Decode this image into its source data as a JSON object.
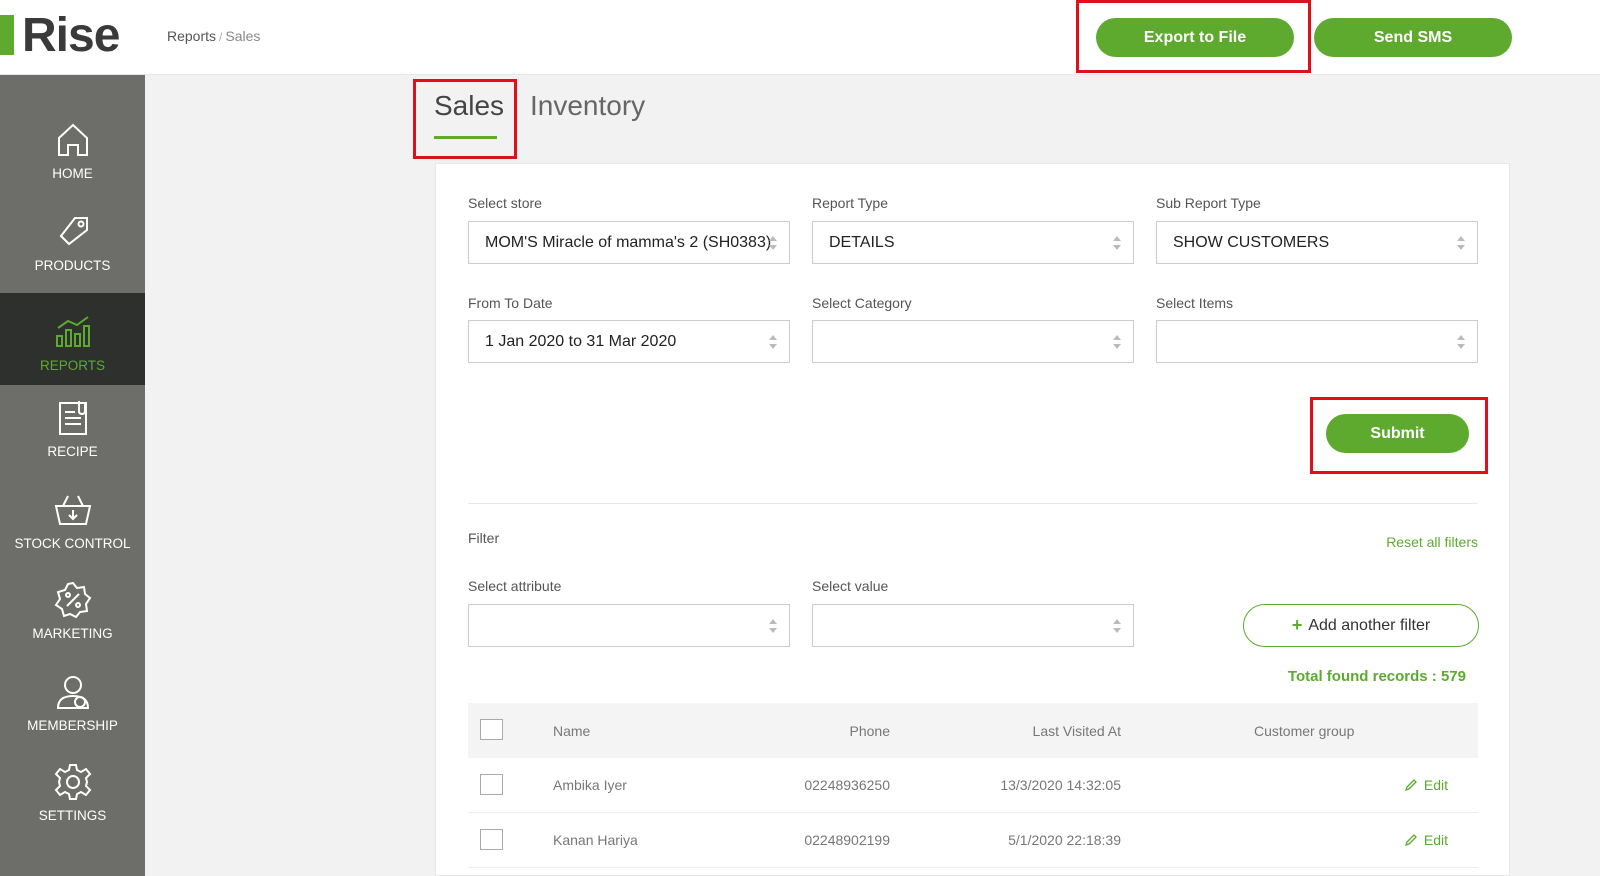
{
  "app": {
    "logo": "Rise"
  },
  "breadcrumb": {
    "parent": "Reports",
    "separator": "/",
    "current": "Sales"
  },
  "header": {
    "export_label": "Export to File",
    "sms_label": "Send SMS"
  },
  "sidebar": {
    "items": [
      {
        "label": "HOME",
        "icon": "home-icon"
      },
      {
        "label": "PRODUCTS",
        "icon": "tag-icon"
      },
      {
        "label": "REPORTS",
        "icon": "chart-icon",
        "active": true
      },
      {
        "label": "RECIPE",
        "icon": "recipe-icon"
      },
      {
        "label": "STOCK CONTROL",
        "icon": "basket-icon"
      },
      {
        "label": "MARKETING",
        "icon": "percent-badge-icon"
      },
      {
        "label": "MEMBERSHIP",
        "icon": "members-icon"
      },
      {
        "label": "SETTINGS",
        "icon": "gear-icon"
      }
    ]
  },
  "tabs": {
    "sales": "Sales",
    "inventory": "Inventory"
  },
  "form": {
    "store_label": "Select store",
    "store_value": "MOM'S Miracle of mamma's 2 (SH0383)",
    "report_type_label": "Report Type",
    "report_type_value": "DETAILS",
    "sub_report_label": "Sub Report Type",
    "sub_report_value": "SHOW CUSTOMERS",
    "date_label": "From To Date",
    "date_value": "1 Jan 2020 to 31 Mar 2020",
    "category_label": "Select Category",
    "category_value": "",
    "items_label": "Select Items",
    "items_value": "",
    "submit_label": "Submit"
  },
  "filter": {
    "title": "Filter",
    "reset_label": "Reset all filters",
    "attribute_label": "Select attribute",
    "attribute_value": "",
    "value_label": "Select value",
    "value_value": "",
    "add_label": "Add another filter",
    "total_text": "Total found records : 579"
  },
  "table": {
    "headers": {
      "name": "Name",
      "phone": "Phone",
      "last_visited": "Last Visited At",
      "group": "Customer group"
    },
    "edit_label": "Edit",
    "rows": [
      {
        "name": "Ambika Iyer",
        "phone": "02248936250",
        "last_visited": "13/3/2020 14:32:05",
        "group": ""
      },
      {
        "name": "Kanan Hariya",
        "phone": "02248902199",
        "last_visited": "5/1/2020 22:18:39",
        "group": ""
      }
    ]
  },
  "colors": {
    "accent": "#5eaa2f",
    "sidebar": "#6d6e6a",
    "sidebar_active": "#2d302c",
    "highlight": "#e0101a"
  }
}
